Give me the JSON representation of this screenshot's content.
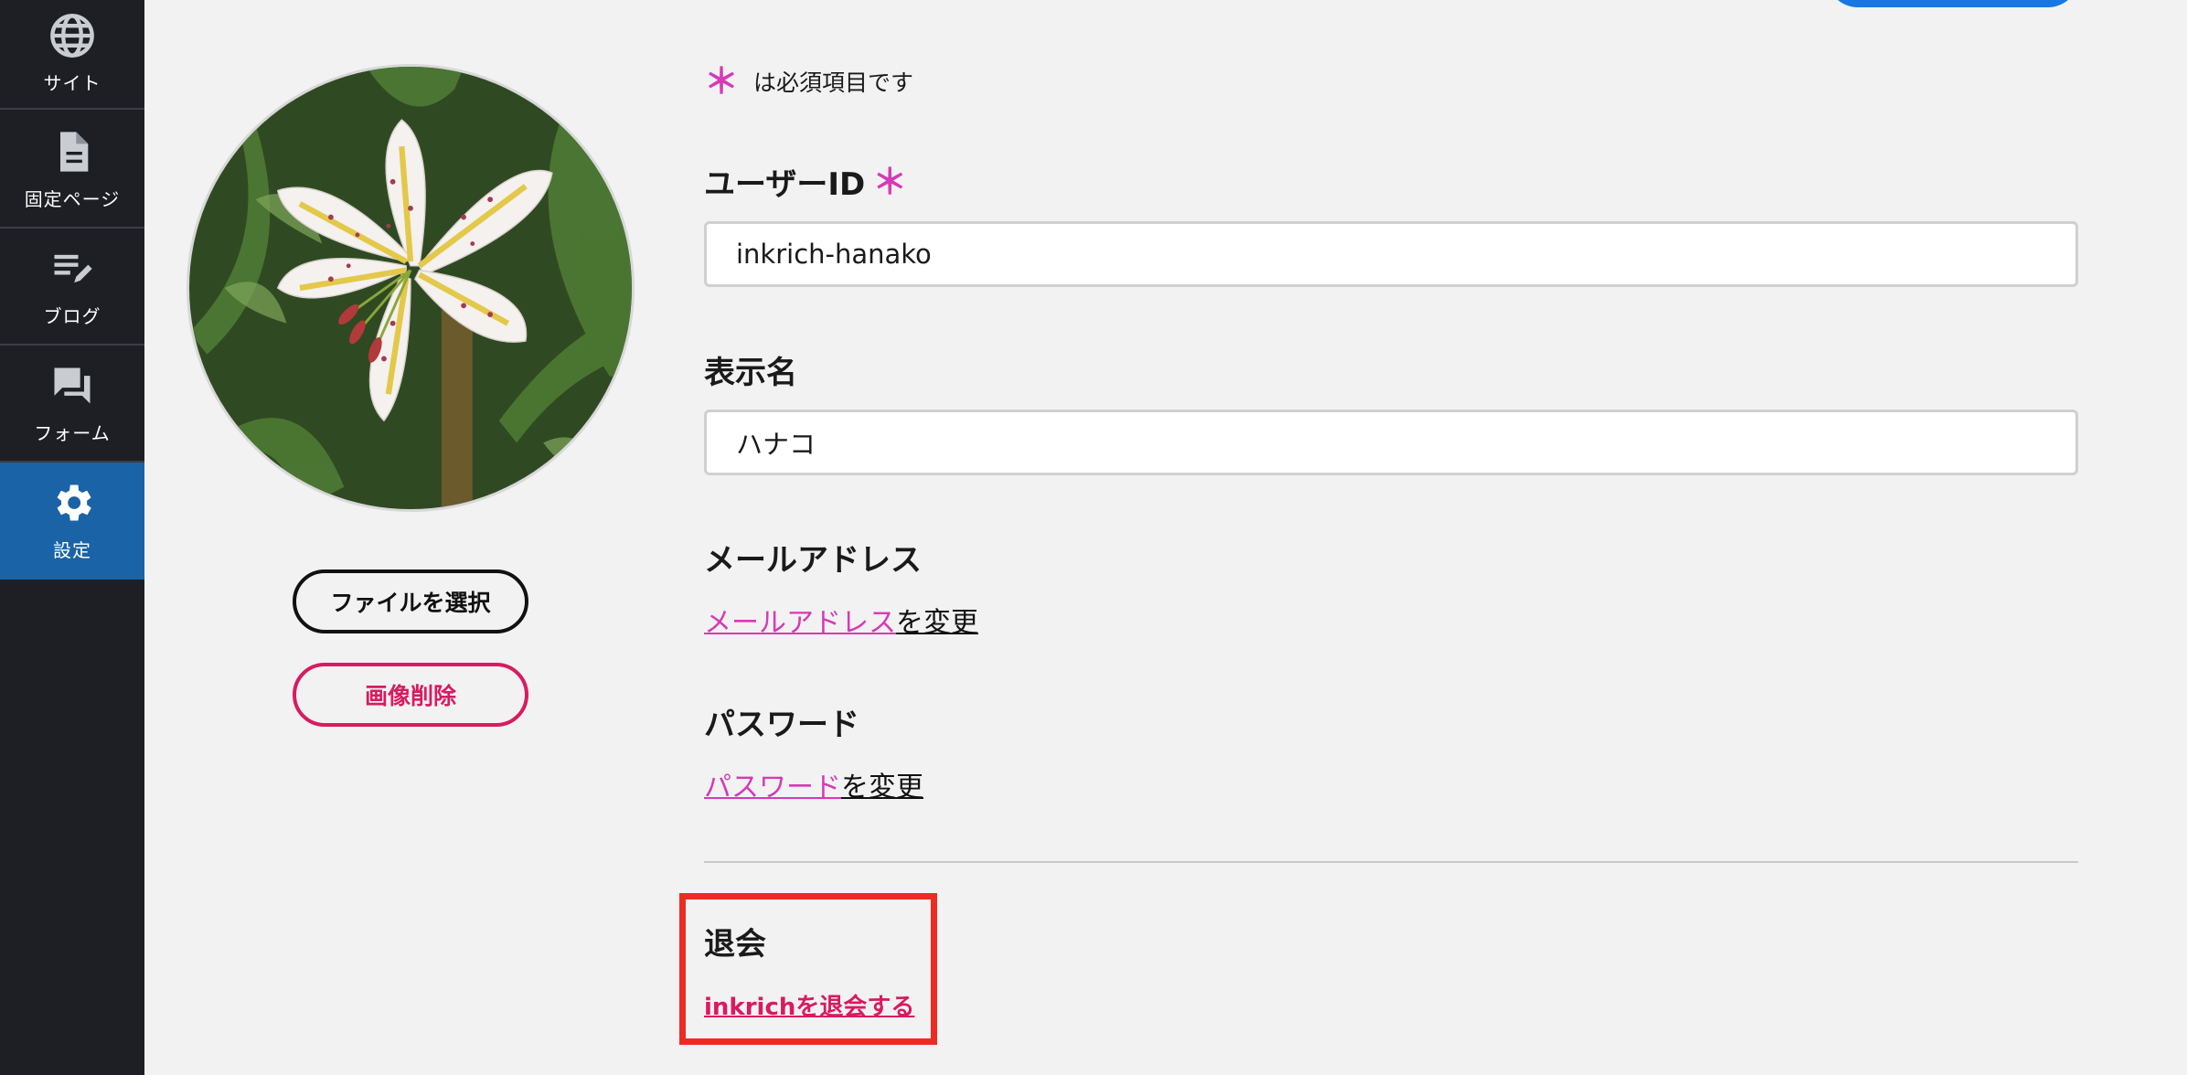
{
  "sidebar": {
    "items": [
      {
        "label": "サイト",
        "icon": "globe-icon"
      },
      {
        "label": "固定ページ",
        "icon": "document-icon"
      },
      {
        "label": "ブログ",
        "icon": "edit-list-icon"
      },
      {
        "label": "フォーム",
        "icon": "chat-icon"
      },
      {
        "label": "設定",
        "icon": "gear-icon",
        "active": true
      }
    ]
  },
  "colors": {
    "sidebar_bg": "#1d1f24",
    "active_bg": "#1a63a6",
    "accent_pink": "#d63ab6",
    "danger": "#d81b60",
    "highlight": "#ee2b22",
    "primary_blue": "#1777e4"
  },
  "profile": {
    "avatar_alt": "lily-flower-photo",
    "select_file_label": "ファイルを選択",
    "delete_image_label": "画像削除"
  },
  "form": {
    "required_note": "は必須項目です",
    "required_mark": "＊",
    "user_id": {
      "label": "ユーザーID",
      "value": "inkrich-hanako"
    },
    "display_name": {
      "label": "表示名",
      "value": "ハナコ"
    },
    "email": {
      "label": "メールアドレス",
      "link_text": "メールアドレス",
      "link_suffix": "を変更"
    },
    "password": {
      "label": "パスワード",
      "link_text": "パスワード",
      "link_suffix": "を変更"
    },
    "withdraw": {
      "label": "退会",
      "link_text": "inkrichを退会する"
    }
  }
}
